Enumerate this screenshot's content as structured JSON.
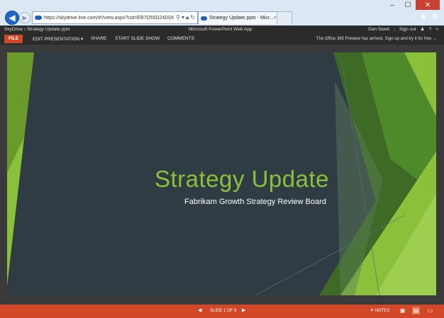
{
  "browser": {
    "window_controls": {
      "minimize": "–",
      "maximize": "☐",
      "close": "✕"
    },
    "address": {
      "url": "https://skydrive.live.com/#!/view.aspx?cid=EB7D55D24DD84",
      "tools": [
        "search-icon",
        "dropdown-icon",
        "lock-icon",
        "refresh-icon"
      ]
    },
    "tab": {
      "title": "Strategy Update.pptx - Micr...",
      "close": "×"
    },
    "right_icons": {
      "home": "⌂",
      "favorites": "★",
      "settings": "⚙"
    }
  },
  "app_header": {
    "breadcrumb_root": "SkyDrive",
    "breadcrumb_sep": "›",
    "breadcrumb_file": "Strategy Update.pptx",
    "app_title": "Microsoft PowerPoint Web App",
    "user": "Dan Swett",
    "sign_out": "Sign out",
    "help": "?",
    "close": "×"
  },
  "ribbon": {
    "file": "FILE",
    "edit": "EDIT PRESENTATION ▾",
    "share": "SHARE",
    "slideshow": "START SLIDE SHOW",
    "comments": "COMMENTS",
    "promo": "The Office 365 Preview has arrived. Sign up and try it for free →"
  },
  "slide": {
    "title": "Strategy Update",
    "subtitle": "Fabrikam Growth Strategy Review Board",
    "colors": {
      "background": "#2f3c44",
      "accent": "#8bc03a"
    }
  },
  "status_bar": {
    "prev": "◀",
    "counter": "SLIDE 1 OF 6",
    "next": "▶",
    "notes": "≜ NOTES",
    "color": "#d24726"
  }
}
